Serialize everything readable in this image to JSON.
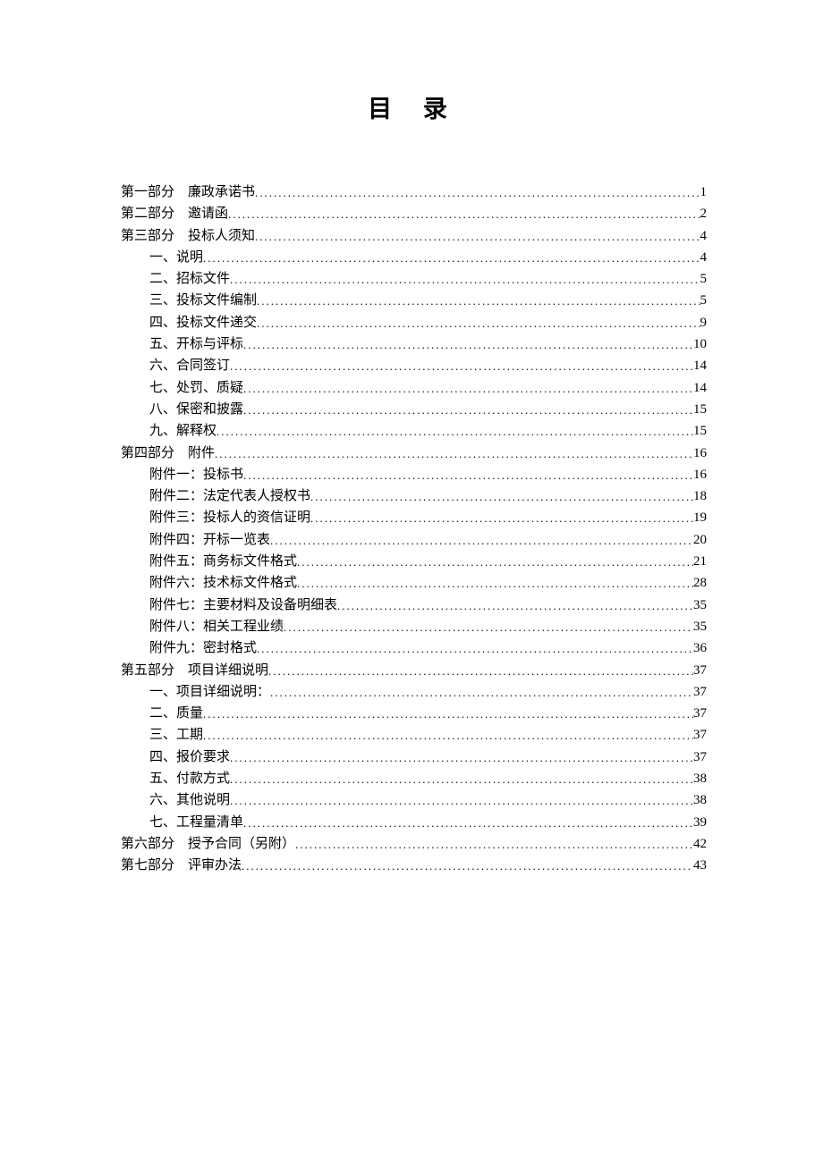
{
  "title": "目 录",
  "entries": [
    {
      "level": 1,
      "label": "第一部分　廉政承诺书",
      "page": "1"
    },
    {
      "level": 1,
      "label": "第二部分　邀请函",
      "page": "2"
    },
    {
      "level": 1,
      "label": "第三部分　投标人须知",
      "page": "4"
    },
    {
      "level": 2,
      "label": "一、说明",
      "page": "4"
    },
    {
      "level": 2,
      "label": "二、招标文件",
      "page": "5"
    },
    {
      "level": 2,
      "label": "三、投标文件编制",
      "page": "5"
    },
    {
      "level": 2,
      "label": "四、投标文件递交",
      "page": "9"
    },
    {
      "level": 2,
      "label": "五、开标与评标",
      "page": "10"
    },
    {
      "level": 2,
      "label": "六、合同签订",
      "page": "14"
    },
    {
      "level": 2,
      "label": "七、处罚、质疑",
      "page": "14"
    },
    {
      "level": 2,
      "label": "八、保密和披露",
      "page": "15"
    },
    {
      "level": 2,
      "label": "九、解释权",
      "page": "15"
    },
    {
      "level": 1,
      "label": "第四部分　附件",
      "page": "16"
    },
    {
      "level": 2,
      "label": "附件一：投标书",
      "page": "16"
    },
    {
      "level": 2,
      "label": "附件二：法定代表人授权书",
      "page": "18"
    },
    {
      "level": 2,
      "label": "附件三：投标人的资信证明",
      "page": "19"
    },
    {
      "level": 2,
      "label": "附件四：开标一览表",
      "page": "20"
    },
    {
      "level": 2,
      "label": "附件五：商务标文件格式",
      "page": "21"
    },
    {
      "level": 2,
      "label": "附件六：技术标文件格式",
      "page": "28"
    },
    {
      "level": 2,
      "label": "附件七：主要材料及设备明细表",
      "page": "35"
    },
    {
      "level": 2,
      "label": "附件八：相关工程业绩",
      "page": "35"
    },
    {
      "level": 2,
      "label": "附件九：密封格式",
      "page": "36"
    },
    {
      "level": 1,
      "label": "第五部分　项目详细说明",
      "page": "37"
    },
    {
      "level": 2,
      "label": "一、项目详细说明：",
      "page": "37"
    },
    {
      "level": 2,
      "label": "二、质量",
      "page": "37"
    },
    {
      "level": 2,
      "label": "三、工期",
      "page": "37"
    },
    {
      "level": 2,
      "label": "四、报价要求",
      "page": "37"
    },
    {
      "level": 2,
      "label": "五、付款方式",
      "page": "38"
    },
    {
      "level": 2,
      "label": "六、其他说明",
      "page": "38"
    },
    {
      "level": 2,
      "label": "七、工程量清单",
      "page": "39"
    },
    {
      "level": 1,
      "label": "第六部分　授予合同（另附）",
      "page": "42"
    },
    {
      "level": 1,
      "label": "第七部分　评审办法",
      "page": "43"
    }
  ]
}
